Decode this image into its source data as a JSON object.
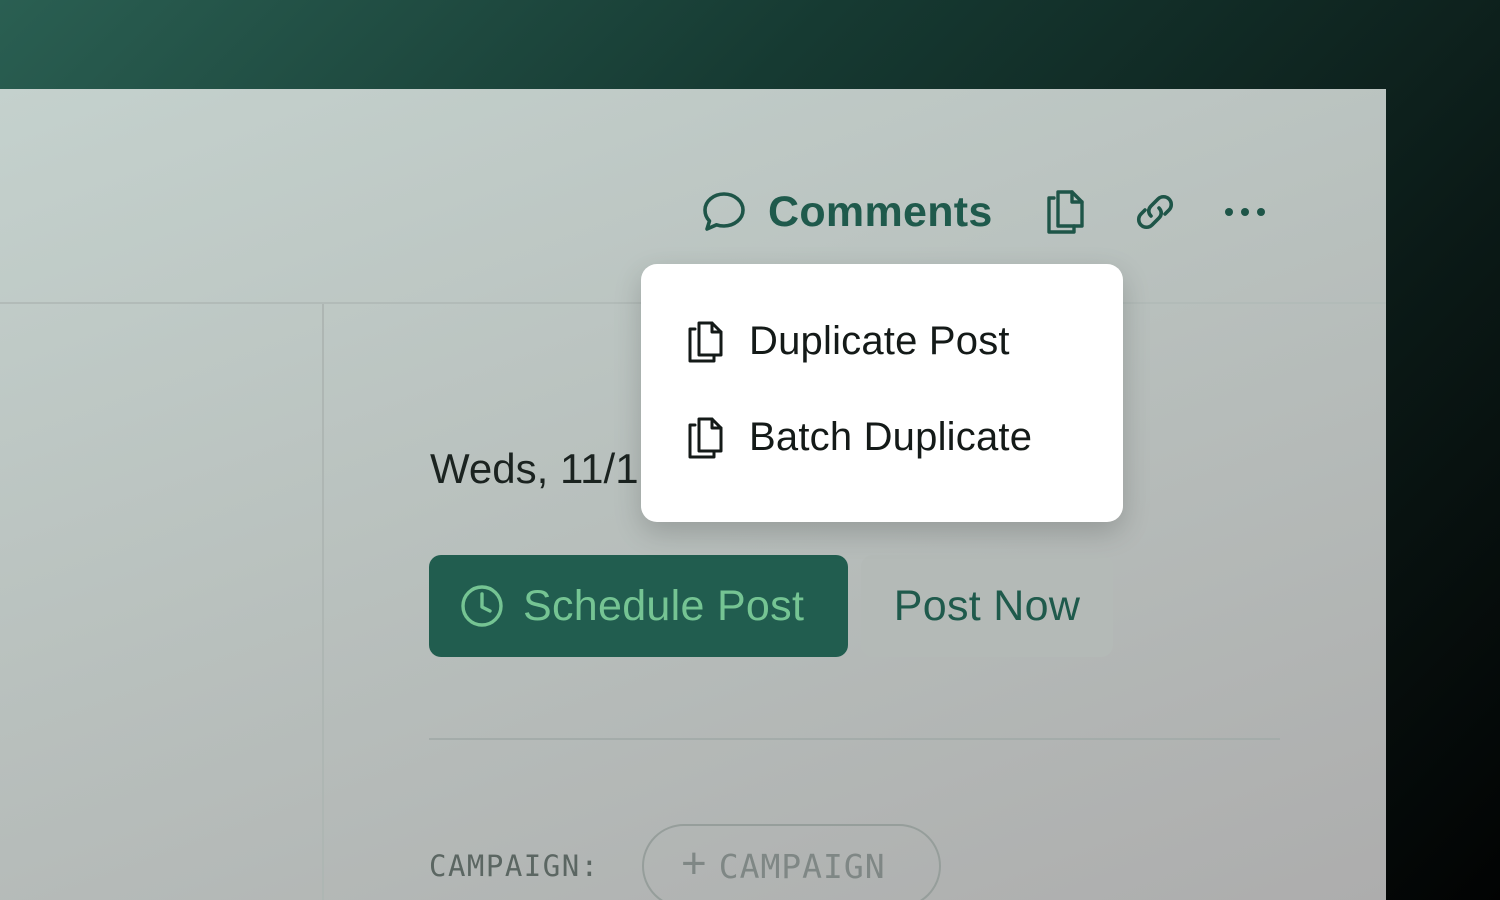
{
  "toolbar": {
    "comments_label": "Comments",
    "icons": {
      "comments": "chat-bubble-icon",
      "duplicate": "duplicate-icon",
      "link": "link-icon",
      "more": "more-horizontal-icon"
    }
  },
  "post": {
    "date_text": "Weds, 11/1",
    "schedule_button_label": "Schedule Post",
    "post_now_button_label": "Post Now"
  },
  "campaign": {
    "label": "CAMPAIGN:",
    "add_chip_label": "CAMPAIGN",
    "add_chip_icon": "plus-icon"
  },
  "dropdown": {
    "items": [
      {
        "label": "Duplicate Post",
        "icon": "duplicate-icon"
      },
      {
        "label": "Batch Duplicate",
        "icon": "duplicate-icon"
      }
    ]
  },
  "colors": {
    "primary": "#215d4f",
    "primary_text": "#75c493",
    "accent_text": "#1f5a4c",
    "menu_background": "#ffffff"
  }
}
